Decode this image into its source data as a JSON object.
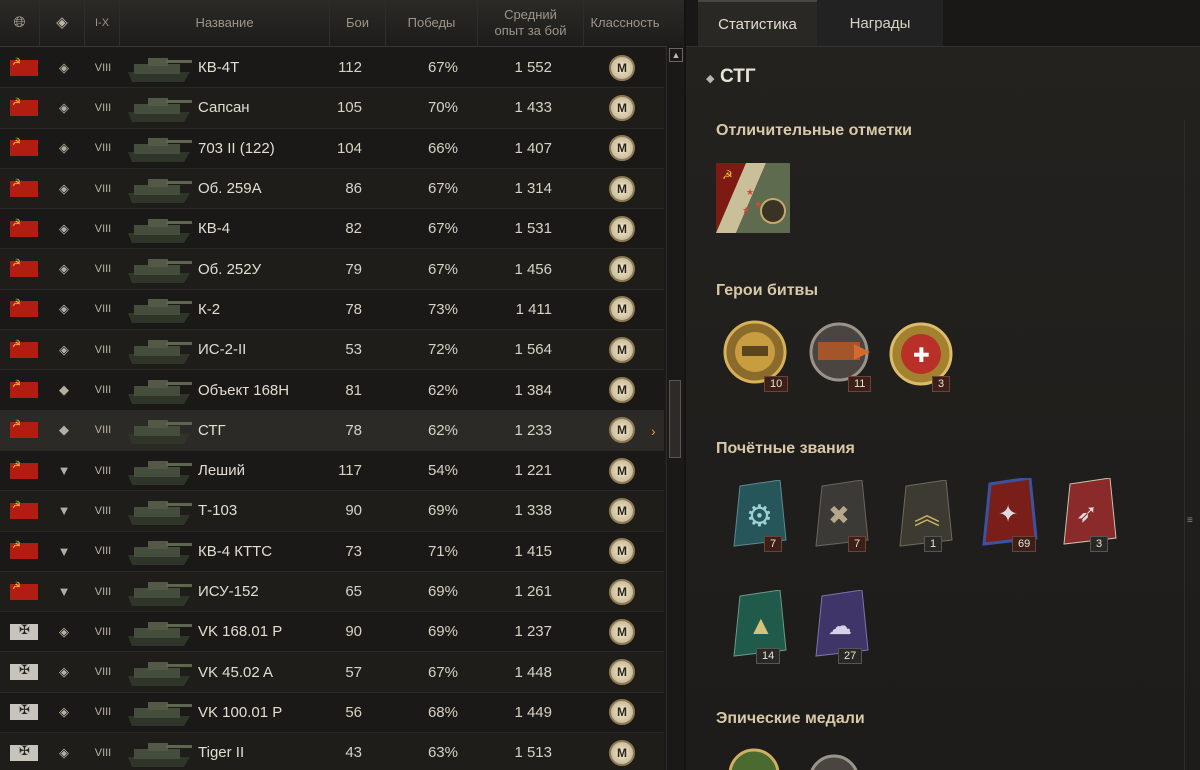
{
  "table": {
    "headers": {
      "name": "Название",
      "battles": "Бои",
      "wins": "Победы",
      "avg_xp": "Средний опыт за бой",
      "mastery": "Классность",
      "tier_filter": "I-X"
    },
    "rows": [
      {
        "nation": "ussr",
        "cls": "heavy",
        "tier": "VIII",
        "name": "КВ-4Т",
        "battles": "112",
        "wins": "67%",
        "xp": "1 552",
        "mastery": "M"
      },
      {
        "nation": "ussr",
        "cls": "heavy",
        "tier": "VIII",
        "name": "Сапсан",
        "battles": "105",
        "wins": "70%",
        "xp": "1 433",
        "mastery": "M"
      },
      {
        "nation": "ussr",
        "cls": "heavy",
        "tier": "VIII",
        "name": "703 II (122)",
        "battles": "104",
        "wins": "66%",
        "xp": "1 407",
        "mastery": "M"
      },
      {
        "nation": "ussr",
        "cls": "heavy",
        "tier": "VIII",
        "name": "Об. 259А",
        "battles": "86",
        "wins": "67%",
        "xp": "1 314",
        "mastery": "M"
      },
      {
        "nation": "ussr",
        "cls": "heavy",
        "tier": "VIII",
        "name": "КВ-4",
        "battles": "82",
        "wins": "67%",
        "xp": "1 531",
        "mastery": "M"
      },
      {
        "nation": "ussr",
        "cls": "heavy",
        "tier": "VIII",
        "name": "Об. 252У",
        "battles": "79",
        "wins": "67%",
        "xp": "1 456",
        "mastery": "M"
      },
      {
        "nation": "ussr",
        "cls": "heavy",
        "tier": "VIII",
        "name": "К-2",
        "battles": "78",
        "wins": "73%",
        "xp": "1 411",
        "mastery": "M"
      },
      {
        "nation": "ussr",
        "cls": "heavy",
        "tier": "VIII",
        "name": "ИС-2-II",
        "battles": "53",
        "wins": "72%",
        "xp": "1 564",
        "mastery": "M"
      },
      {
        "nation": "ussr",
        "cls": "medium",
        "tier": "VIII",
        "name": "Объект 168Н",
        "battles": "81",
        "wins": "62%",
        "xp": "1 384",
        "mastery": "M"
      },
      {
        "nation": "ussr",
        "cls": "medium",
        "tier": "VIII",
        "name": "СТГ",
        "battles": "78",
        "wins": "62%",
        "xp": "1 233",
        "mastery": "M",
        "selected": true
      },
      {
        "nation": "ussr",
        "cls": "td",
        "tier": "VIII",
        "name": "Леший",
        "battles": "117",
        "wins": "54%",
        "xp": "1 221",
        "mastery": "M"
      },
      {
        "nation": "ussr",
        "cls": "td",
        "tier": "VIII",
        "name": "Т-103",
        "battles": "90",
        "wins": "69%",
        "xp": "1 338",
        "mastery": "M"
      },
      {
        "nation": "ussr",
        "cls": "td",
        "tier": "VIII",
        "name": "КВ-4 КТТС",
        "battles": "73",
        "wins": "71%",
        "xp": "1 415",
        "mastery": "M"
      },
      {
        "nation": "ussr",
        "cls": "td",
        "tier": "VIII",
        "name": "ИСУ-152",
        "battles": "65",
        "wins": "69%",
        "xp": "1 261",
        "mastery": "M"
      },
      {
        "nation": "germany",
        "cls": "heavy",
        "tier": "VIII",
        "name": "VK 168.01 P",
        "battles": "90",
        "wins": "69%",
        "xp": "1 237",
        "mastery": "M"
      },
      {
        "nation": "germany",
        "cls": "heavy",
        "tier": "VIII",
        "name": "VK 45.02 A",
        "battles": "57",
        "wins": "67%",
        "xp": "1 448",
        "mastery": "M"
      },
      {
        "nation": "germany",
        "cls": "heavy",
        "tier": "VIII",
        "name": "VK 100.01 P",
        "battles": "56",
        "wins": "68%",
        "xp": "1 449",
        "mastery": "M"
      },
      {
        "nation": "germany",
        "cls": "heavy",
        "tier": "VIII",
        "name": "Tiger II",
        "battles": "43",
        "wins": "63%",
        "xp": "1 513",
        "mastery": "M"
      }
    ]
  },
  "panel": {
    "tabs": [
      "Статистика",
      "Награды"
    ],
    "vehicle": "СТГ",
    "sections": {
      "marks": "Отличительные отметки",
      "heroes": "Герои битвы",
      "titles": "Почётные звания",
      "epic": "Эпические медали"
    },
    "hero_counts": [
      "10",
      "11",
      "3"
    ],
    "title_counts": [
      "7",
      "7",
      "1",
      "69",
      "3",
      "14",
      "27"
    ]
  },
  "colors": {
    "accent": "#e0a030",
    "ussr_red": "#b11d12"
  }
}
